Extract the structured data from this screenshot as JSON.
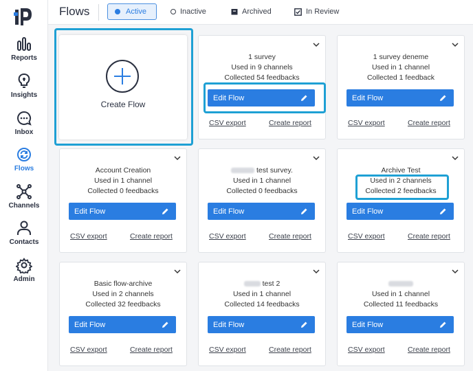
{
  "app": {
    "brand_color": "#2a7de1",
    "highlight_color": "#1ea0d4"
  },
  "sidebar": {
    "items": [
      {
        "label": "Reports",
        "icon": "bar-chart-icon"
      },
      {
        "label": "Insights",
        "icon": "lightbulb-icon"
      },
      {
        "label": "Inbox",
        "icon": "chat-bubble-icon"
      },
      {
        "label": "Flows",
        "icon": "flows-cycle-icon",
        "active": true
      },
      {
        "label": "Channels",
        "icon": "network-icon"
      },
      {
        "label": "Contacts",
        "icon": "person-icon"
      },
      {
        "label": "Admin",
        "icon": "gear-icon"
      }
    ]
  },
  "header": {
    "title": "Flows",
    "tabs": [
      {
        "label": "Active",
        "active": true
      },
      {
        "label": "Inactive"
      },
      {
        "label": "Archived"
      },
      {
        "label": "In Review"
      }
    ]
  },
  "create": {
    "label": "Create Flow"
  },
  "common": {
    "edit": "Edit Flow",
    "csv": "CSV export",
    "report": "Create report"
  },
  "cards": [
    {
      "name": "1 survey",
      "channels": "Used in 9 channels",
      "feedbacks": "Collected 54 feedbacks"
    },
    {
      "name": "1 survey deneme",
      "channels": "Used in 1 channel",
      "feedbacks": "Collected 1 feedback"
    },
    {
      "name": "Account Creation",
      "channels": "Used in 1 channel",
      "feedbacks": "Collected 0 feedbacks"
    },
    {
      "name": "test survey.",
      "channels": "Used in 1 channel",
      "feedbacks": "Collected 0 feedbacks"
    },
    {
      "name": "Archive Test",
      "channels": "Used in 2 channels",
      "feedbacks": "Collected 2 feedbacks"
    },
    {
      "name": "Basic flow-archive",
      "channels": "Used in 2 channels",
      "feedbacks": "Collected 32 feedbacks"
    },
    {
      "name": "test 2",
      "channels": "Used in 1 channel",
      "feedbacks": "Collected 14 feedbacks"
    },
    {
      "name": "",
      "channels": "Used in 1 channel",
      "feedbacks": "Collected 11 feedbacks"
    }
  ]
}
